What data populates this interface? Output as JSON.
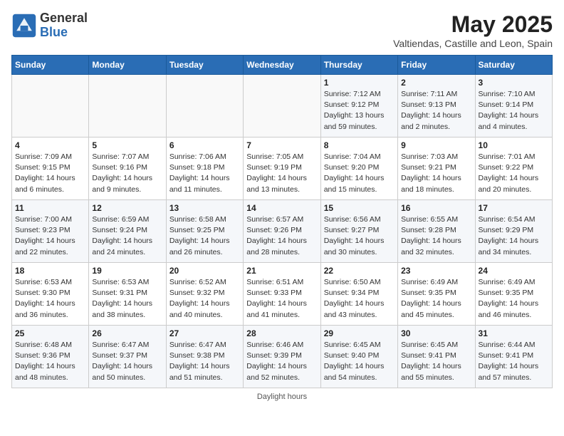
{
  "logo": {
    "line1": "General",
    "line2": "Blue"
  },
  "title": "May 2025",
  "subtitle": "Valtiendas, Castille and Leon, Spain",
  "days_of_week": [
    "Sunday",
    "Monday",
    "Tuesday",
    "Wednesday",
    "Thursday",
    "Friday",
    "Saturday"
  ],
  "weeks": [
    [
      {
        "day": "",
        "info": ""
      },
      {
        "day": "",
        "info": ""
      },
      {
        "day": "",
        "info": ""
      },
      {
        "day": "",
        "info": ""
      },
      {
        "day": "1",
        "info": "Sunrise: 7:12 AM\nSunset: 9:12 PM\nDaylight: 13 hours and 59 minutes."
      },
      {
        "day": "2",
        "info": "Sunrise: 7:11 AM\nSunset: 9:13 PM\nDaylight: 14 hours and 2 minutes."
      },
      {
        "day": "3",
        "info": "Sunrise: 7:10 AM\nSunset: 9:14 PM\nDaylight: 14 hours and 4 minutes."
      }
    ],
    [
      {
        "day": "4",
        "info": "Sunrise: 7:09 AM\nSunset: 9:15 PM\nDaylight: 14 hours and 6 minutes."
      },
      {
        "day": "5",
        "info": "Sunrise: 7:07 AM\nSunset: 9:16 PM\nDaylight: 14 hours and 9 minutes."
      },
      {
        "day": "6",
        "info": "Sunrise: 7:06 AM\nSunset: 9:18 PM\nDaylight: 14 hours and 11 minutes."
      },
      {
        "day": "7",
        "info": "Sunrise: 7:05 AM\nSunset: 9:19 PM\nDaylight: 14 hours and 13 minutes."
      },
      {
        "day": "8",
        "info": "Sunrise: 7:04 AM\nSunset: 9:20 PM\nDaylight: 14 hours and 15 minutes."
      },
      {
        "day": "9",
        "info": "Sunrise: 7:03 AM\nSunset: 9:21 PM\nDaylight: 14 hours and 18 minutes."
      },
      {
        "day": "10",
        "info": "Sunrise: 7:01 AM\nSunset: 9:22 PM\nDaylight: 14 hours and 20 minutes."
      }
    ],
    [
      {
        "day": "11",
        "info": "Sunrise: 7:00 AM\nSunset: 9:23 PM\nDaylight: 14 hours and 22 minutes."
      },
      {
        "day": "12",
        "info": "Sunrise: 6:59 AM\nSunset: 9:24 PM\nDaylight: 14 hours and 24 minutes."
      },
      {
        "day": "13",
        "info": "Sunrise: 6:58 AM\nSunset: 9:25 PM\nDaylight: 14 hours and 26 minutes."
      },
      {
        "day": "14",
        "info": "Sunrise: 6:57 AM\nSunset: 9:26 PM\nDaylight: 14 hours and 28 minutes."
      },
      {
        "day": "15",
        "info": "Sunrise: 6:56 AM\nSunset: 9:27 PM\nDaylight: 14 hours and 30 minutes."
      },
      {
        "day": "16",
        "info": "Sunrise: 6:55 AM\nSunset: 9:28 PM\nDaylight: 14 hours and 32 minutes."
      },
      {
        "day": "17",
        "info": "Sunrise: 6:54 AM\nSunset: 9:29 PM\nDaylight: 14 hours and 34 minutes."
      }
    ],
    [
      {
        "day": "18",
        "info": "Sunrise: 6:53 AM\nSunset: 9:30 PM\nDaylight: 14 hours and 36 minutes."
      },
      {
        "day": "19",
        "info": "Sunrise: 6:53 AM\nSunset: 9:31 PM\nDaylight: 14 hours and 38 minutes."
      },
      {
        "day": "20",
        "info": "Sunrise: 6:52 AM\nSunset: 9:32 PM\nDaylight: 14 hours and 40 minutes."
      },
      {
        "day": "21",
        "info": "Sunrise: 6:51 AM\nSunset: 9:33 PM\nDaylight: 14 hours and 41 minutes."
      },
      {
        "day": "22",
        "info": "Sunrise: 6:50 AM\nSunset: 9:34 PM\nDaylight: 14 hours and 43 minutes."
      },
      {
        "day": "23",
        "info": "Sunrise: 6:49 AM\nSunset: 9:35 PM\nDaylight: 14 hours and 45 minutes."
      },
      {
        "day": "24",
        "info": "Sunrise: 6:49 AM\nSunset: 9:35 PM\nDaylight: 14 hours and 46 minutes."
      }
    ],
    [
      {
        "day": "25",
        "info": "Sunrise: 6:48 AM\nSunset: 9:36 PM\nDaylight: 14 hours and 48 minutes."
      },
      {
        "day": "26",
        "info": "Sunrise: 6:47 AM\nSunset: 9:37 PM\nDaylight: 14 hours and 50 minutes."
      },
      {
        "day": "27",
        "info": "Sunrise: 6:47 AM\nSunset: 9:38 PM\nDaylight: 14 hours and 51 minutes."
      },
      {
        "day": "28",
        "info": "Sunrise: 6:46 AM\nSunset: 9:39 PM\nDaylight: 14 hours and 52 minutes."
      },
      {
        "day": "29",
        "info": "Sunrise: 6:45 AM\nSunset: 9:40 PM\nDaylight: 14 hours and 54 minutes."
      },
      {
        "day": "30",
        "info": "Sunrise: 6:45 AM\nSunset: 9:41 PM\nDaylight: 14 hours and 55 minutes."
      },
      {
        "day": "31",
        "info": "Sunrise: 6:44 AM\nSunset: 9:41 PM\nDaylight: 14 hours and 57 minutes."
      }
    ]
  ],
  "footer": "Daylight hours"
}
